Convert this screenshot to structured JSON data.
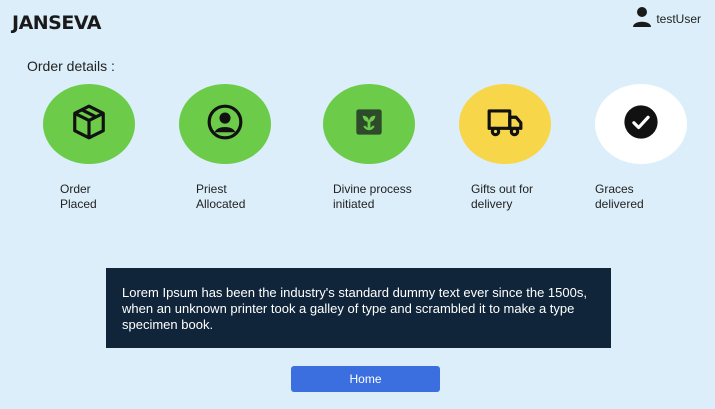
{
  "header": {
    "logo": "JANSEVA",
    "user_name": "testUser",
    "user_icon": "user-icon"
  },
  "order": {
    "title": "Order details :",
    "steps": [
      {
        "label": "Order\nPlaced",
        "icon": "package-icon",
        "color": "#6ccc4a"
      },
      {
        "label": "Priest\nAllocated",
        "icon": "person-icon",
        "color": "#6ccc4a"
      },
      {
        "label": "Divine process\ninitiated",
        "icon": "plant-icon",
        "color": "#6ccc4a"
      },
      {
        "label": "Gifts out for\ndelivery",
        "icon": "truck-icon",
        "color": "#f7d64a"
      },
      {
        "label": "Graces\ndelivered",
        "icon": "checkmark-icon",
        "color": "#ffffff"
      }
    ]
  },
  "notice": {
    "text": "Lorem Ipsum has been the industry's standard dummy text ever since the 1500s, when an unknown printer took a galley of type and scrambled it to make a type specimen book."
  },
  "actions": {
    "home_label": "Home",
    "home_color": "#3b6fe0"
  }
}
